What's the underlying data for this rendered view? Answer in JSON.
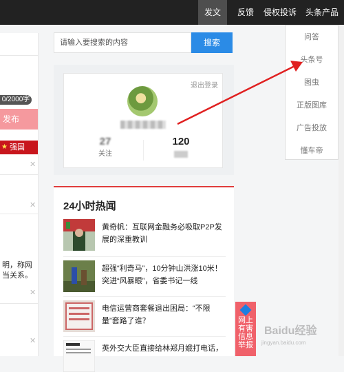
{
  "nav": {
    "publish": "发文",
    "feedback": "反馈",
    "report": "侵权投诉",
    "products": "头条产品"
  },
  "left": {
    "count": "0/2000字",
    "publish": "发布",
    "banner": "强国",
    "text1": "明，称网",
    "text2": "当关系。"
  },
  "search": {
    "placeholder": "请输入要搜索的内容",
    "button": "搜索"
  },
  "profile": {
    "logout": "退出登录",
    "following_count": "27",
    "following_label": "关注",
    "followers_count": "120"
  },
  "hot": {
    "title": "24小时热闻",
    "items": [
      {
        "text": "黄奇帆：互联网金融务必吸取P2P发展的深重教训"
      },
      {
        "text": "超强“利奇马”，10分钟山洪涨10米！突进“风暴眼”，省委书记一线"
      },
      {
        "text": "电信运营商套餐退出困局：“不限量”套路了谁？"
      },
      {
        "text": "英外交大臣直接给林郑月娥打电话，"
      }
    ]
  },
  "dropdown": {
    "items": [
      "问答",
      "头条号",
      "图虫",
      "正版图库",
      "广告投放",
      "懂车帝"
    ]
  },
  "report_tab": {
    "line1": "网上",
    "line2": "有害",
    "line3": "信息",
    "line4": "举报"
  },
  "watermark": "Baidu经验",
  "watermark_sub": "jingyan.baidu.com",
  "colors": {
    "accent": "#2b8be6",
    "hot_border": "#e03c3c",
    "arrow": "#e02020"
  }
}
